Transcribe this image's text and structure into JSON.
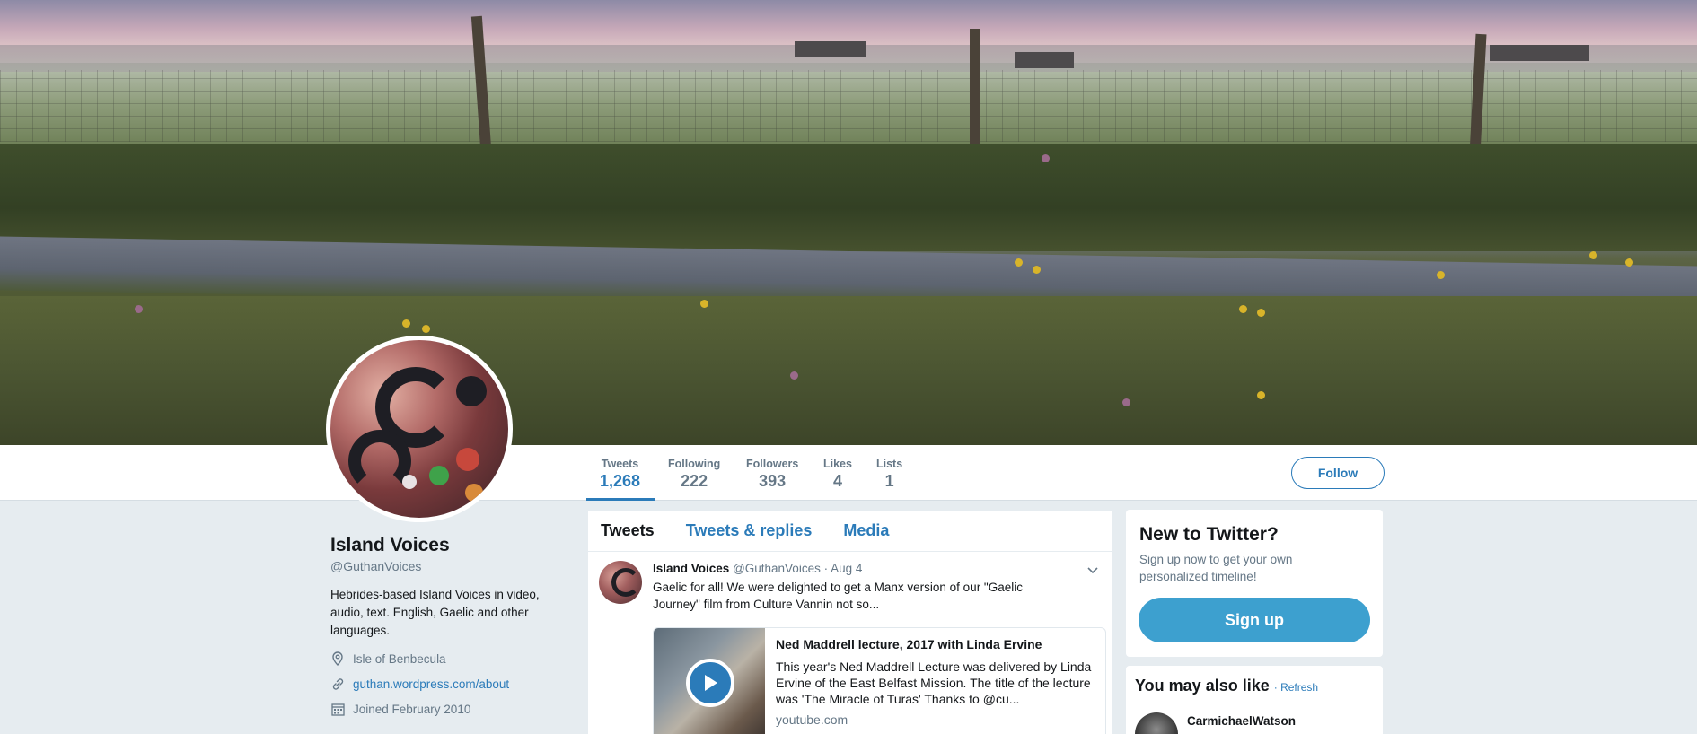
{
  "profile": {
    "name": "Island Voices",
    "handle": "@GuthanVoices",
    "bio": "Hebrides-based Island Voices in video, audio, text. English, Gaelic and other languages.",
    "location": "Isle of Benbecula",
    "website": "guthan.wordpress.com/about",
    "joined": "Joined February 2010"
  },
  "stats": [
    {
      "label": "Tweets",
      "value": "1,268"
    },
    {
      "label": "Following",
      "value": "222"
    },
    {
      "label": "Followers",
      "value": "393"
    },
    {
      "label": "Likes",
      "value": "4"
    },
    {
      "label": "Lists",
      "value": "1"
    }
  ],
  "follow_label": "Follow",
  "tabs": [
    {
      "label": "Tweets"
    },
    {
      "label": "Tweets & replies"
    },
    {
      "label": "Media"
    }
  ],
  "tweet": {
    "name": "Island Voices",
    "handle": "@GuthanVoices",
    "date": "· Aug 4",
    "text": "Gaelic for all! We were delighted to get a Manx version of our \"Gaelic Journey\" film from Culture Vannin not so...",
    "card": {
      "title": "Ned Maddrell lecture, 2017 with Linda Ervine",
      "description": "This year's Ned Maddrell Lecture was delivered by Linda Ervine of the East Belfast Mission. The title of the lecture was 'The Miracle of Turas' Thanks to @cu...",
      "domain": "youtube.com"
    }
  },
  "signup": {
    "title": "New to Twitter?",
    "text": "Sign up now to get your own personalized timeline!",
    "button": "Sign up"
  },
  "suggestions": {
    "title": "You may also like",
    "refresh": "· Refresh",
    "users": [
      {
        "name": "CarmichaelWatson"
      }
    ]
  },
  "colors": {
    "accent": "#2b7bb9",
    "signup_button": "#3da0cf",
    "page_background": "#e6ecf0"
  }
}
